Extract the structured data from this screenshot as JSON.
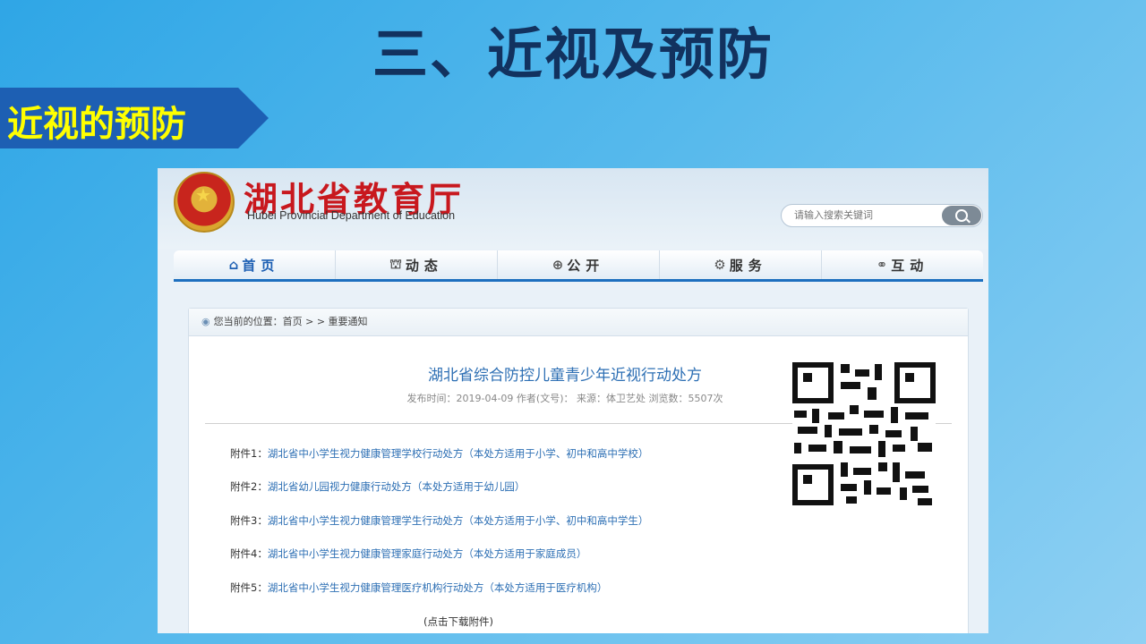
{
  "slide": {
    "title": "三、近视及预防",
    "section_tag": "近视的预防"
  },
  "site": {
    "name": "湖北省教育厅",
    "name_en": "Hubei Provincial Department of Education",
    "search_placeholder": "请输入搜索关键词"
  },
  "nav": [
    {
      "label": "首页",
      "icon": "home-icon",
      "active": true
    },
    {
      "label": "动态",
      "icon": "building-icon",
      "active": false
    },
    {
      "label": "公开",
      "icon": "globe-icon",
      "active": false
    },
    {
      "label": "服务",
      "icon": "gear-icon",
      "active": false
    },
    {
      "label": "互动",
      "icon": "share-icon",
      "active": false
    }
  ],
  "breadcrumb": {
    "prefix": "您当前的位置：",
    "home": "首页",
    "sep": " > > ",
    "current": "重要通知"
  },
  "article": {
    "title": "湖北省综合防控儿童青少年近视行动处方",
    "meta": "发布时间：2019-04-09 作者(文号)： 来源：体卫艺处 浏览数：5507次",
    "attachments": [
      {
        "label": "附件1：",
        "text": "湖北省中小学生视力健康管理学校行动处方（本处方适用于小学、初中和高中学校）"
      },
      {
        "label": "附件2：",
        "text": "湖北省幼儿园视力健康行动处方（本处方适用于幼儿园）"
      },
      {
        "label": "附件3：",
        "text": "湖北省中小学生视力健康管理学生行动处方（本处方适用于小学、初中和高中学生）"
      },
      {
        "label": "附件4：",
        "text": "湖北省中小学生视力健康管理家庭行动处方（本处方适用于家庭成员）"
      },
      {
        "label": "附件5：",
        "text": "湖北省中小学生视力健康管理医疗机构行动处方（本处方适用于医疗机构）"
      }
    ],
    "download_hint": "(点击下载附件)"
  },
  "colors": {
    "slide_title": "#12325f",
    "section_tag_bg": "#1d5fb3",
    "section_tag_text": "#ffff00",
    "site_name": "#c8181e",
    "link": "#2d6fb4"
  }
}
